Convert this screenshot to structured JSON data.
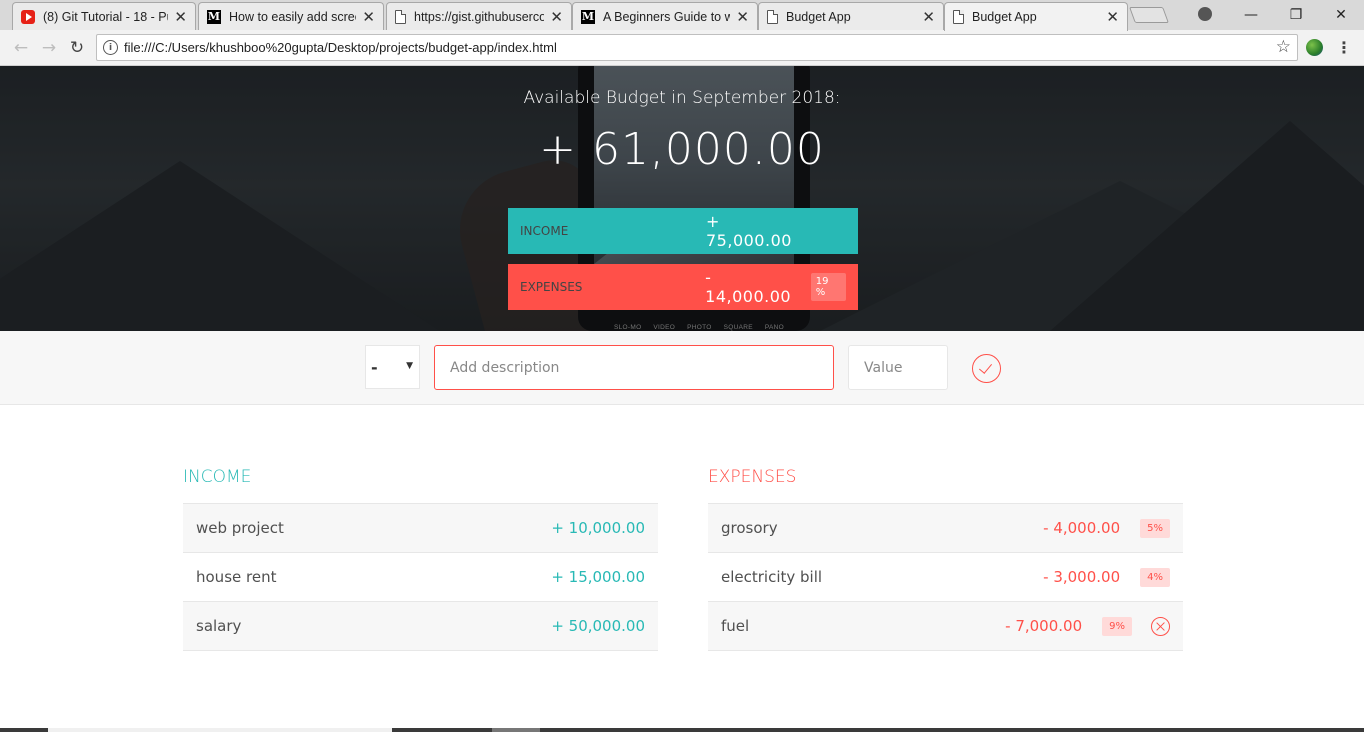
{
  "browser": {
    "tabs": [
      {
        "title": "(8) Git Tutorial - 18 - Pu",
        "favicon": "youtube-icon"
      },
      {
        "title": "How to easily add scree",
        "favicon": "medium-icon"
      },
      {
        "title": "https://gist.githubuserco",
        "favicon": "document-icon"
      },
      {
        "title": "A Beginners Guide to w",
        "favicon": "medium-icon"
      },
      {
        "title": "Budget App",
        "favicon": "document-icon"
      },
      {
        "title": "Budget App",
        "favicon": "document-icon",
        "active": true
      }
    ],
    "url": "file:///C:/Users/khushboo%20gupta/Desktop/projects/budget-app/index.html",
    "favicon_letter": "M",
    "info_glyph": "i"
  },
  "hero": {
    "title": "Available Budget in September 2018:",
    "budget": "+ 61,000.00",
    "income_label": "Income",
    "income_value": "+ 75,000.00",
    "expenses_label": "Expenses",
    "expenses_value": "- 14,000.00",
    "expenses_percentage": "19 %",
    "phone_modes": [
      "SLO-MO",
      "VIDEO",
      "PHOTO",
      "SQUARE",
      "PANO"
    ]
  },
  "add": {
    "type_value": "-",
    "description_placeholder": "Add description",
    "value_placeholder": "Value"
  },
  "income": {
    "heading": "Income",
    "items": [
      {
        "description": "web project",
        "value": "+ 10,000.00"
      },
      {
        "description": "house rent",
        "value": "+ 15,000.00"
      },
      {
        "description": "salary",
        "value": "+ 50,000.00"
      }
    ]
  },
  "expenses": {
    "heading": "Expenses",
    "items": [
      {
        "description": "grosory",
        "value": "- 4,000.00",
        "percentage": "5%"
      },
      {
        "description": "electricity bill",
        "value": "- 3,000.00",
        "percentage": "4%"
      },
      {
        "description": "fuel",
        "value": "- 7,000.00",
        "percentage": "9%"
      }
    ]
  },
  "colors": {
    "income": "#28b9b5",
    "expenses": "#ff5049"
  }
}
